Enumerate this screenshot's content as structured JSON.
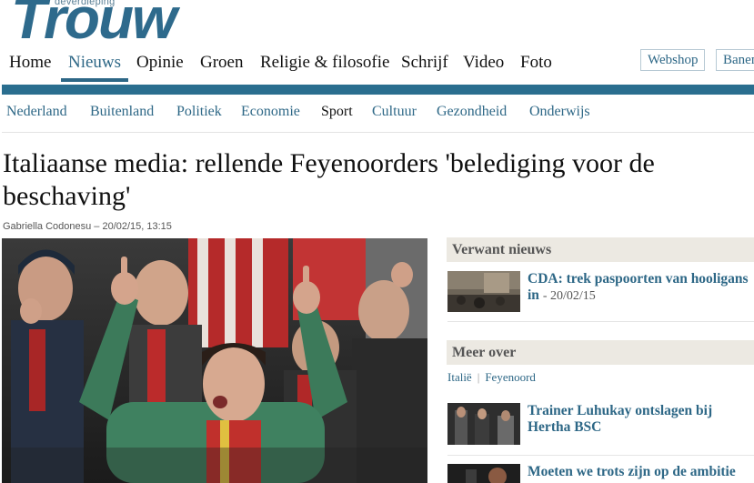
{
  "logo": {
    "tagline": "deverdieping",
    "wordmark": "Trouw"
  },
  "main_nav": [
    "Home",
    "Nieuws",
    "Opinie",
    "Groen",
    "Religie & filosofie",
    "Schrijf",
    "Video",
    "Foto"
  ],
  "header_buttons": {
    "webshop": "Webshop",
    "banen": "Banen"
  },
  "sub_nav": [
    "Nederland",
    "Buitenland",
    "Politiek",
    "Economie",
    "Sport",
    "Cultuur",
    "Gezondheid",
    "Onderwijs"
  ],
  "article": {
    "headline": "Italiaanse media: rellende Feyenoorders 'belediging voor de beschaving'",
    "byline": "Gabriella Codonesu – 20/02/15, 13:15"
  },
  "sidebar": {
    "related_title": "Verwant nieuws",
    "related": [
      {
        "title": "CDA: trek paspoorten van hooligans in",
        "date": "- 20/02/15"
      }
    ],
    "more_title": "Meer over",
    "tags": [
      "Italië",
      "Feyenoord"
    ],
    "more_items": [
      {
        "title": "Trainer Luhukay ontslagen bij Hertha BSC"
      },
      {
        "title": "Moeten we trots zijn op de ambitie"
      }
    ]
  },
  "colors": {
    "brand_blue": "#2d6786",
    "bar": "#2a6e8f",
    "sidebar_header_bg": "#ece9e2"
  }
}
